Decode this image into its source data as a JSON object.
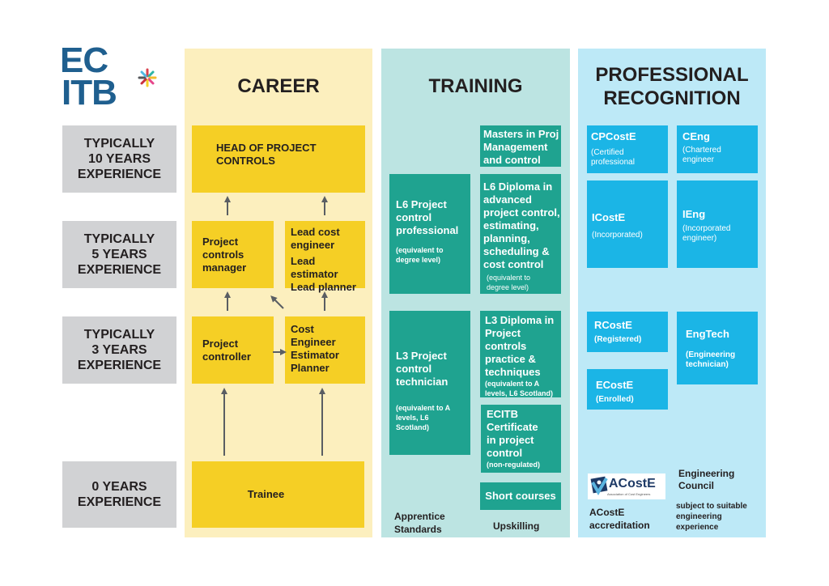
{
  "logo": {
    "line1": "EC",
    "line2": "ITB",
    "color": "#1f5f8f"
  },
  "experience_levels": [
    {
      "lines": [
        "TYPICALLY",
        "10 YEARS",
        "EXPERIENCE"
      ]
    },
    {
      "lines": [
        "TYPICALLY",
        "5 YEARS",
        "EXPERIENCE"
      ]
    },
    {
      "lines": [
        "TYPICALLY",
        "3 YEARS",
        "EXPERIENCE"
      ]
    },
    {
      "lines": [
        "0 YEARS",
        "EXPERIENCE"
      ]
    }
  ],
  "career": {
    "title": "CAREER",
    "head": {
      "lines": [
        "HEAD OF PROJECT",
        "CONTROLS"
      ]
    },
    "manager": {
      "lines": [
        "Project",
        "controls",
        "manager"
      ]
    },
    "lead": {
      "lines": [
        "Lead cost",
        "engineer",
        "Lead estimator",
        "Lead planner"
      ]
    },
    "controller": {
      "lines": [
        "Project",
        "controller"
      ]
    },
    "cost_engineer": {
      "lines": [
        "Cost",
        "Engineer",
        "Estimator",
        "Planner"
      ]
    },
    "trainee": {
      "label": "Trainee"
    }
  },
  "training": {
    "title": "TRAINING",
    "masters": {
      "lines": [
        "Masters in Proj",
        "Management",
        "and control"
      ]
    },
    "l6_professional": {
      "lines": [
        "L6 Project",
        "control",
        "professional"
      ],
      "sub": [
        "(equivalent to",
        "degree level)"
      ]
    },
    "l6_diploma": {
      "lines": [
        "L6 Diploma in",
        "advanced",
        "project control,",
        "estimating,",
        "planning,",
        "scheduling &",
        "cost control"
      ],
      "sub": [
        "(equivalent to",
        "degree level)"
      ]
    },
    "l3_technician": {
      "lines": [
        "L3 Project",
        "control",
        "technician"
      ],
      "sub": [
        "(equivalent to A",
        "levels, L6",
        "Scotland)"
      ]
    },
    "l3_diploma": {
      "lines": [
        "L3 Diploma in",
        "Project",
        "controls",
        "practice &",
        "techniques"
      ],
      "sub": [
        "(equivalent to A",
        "levels, L6 Scotland)"
      ]
    },
    "certificate": {
      "lines": [
        "ECITB",
        "Certificate",
        "in project",
        "control"
      ],
      "sub": [
        "(non-regulated)"
      ]
    },
    "short_courses": {
      "label": "Short courses"
    },
    "footer_left": [
      "Apprentice",
      "Standards"
    ],
    "footer_right": "Upskilling"
  },
  "recognition": {
    "title_lines": [
      "PROFESSIONAL",
      "RECOGNITION"
    ],
    "cpcoste": {
      "title": "CPCostE",
      "sub": [
        "(Certified",
        "professional"
      ]
    },
    "ceng": {
      "title": "CEng",
      "sub": [
        "(Chartered",
        "engineer"
      ]
    },
    "icoste": {
      "title": "ICostE",
      "sub": [
        "(Incorporated)"
      ]
    },
    "ieng": {
      "title": "IEng",
      "sub": [
        "(Incorporated",
        "engineer)"
      ]
    },
    "rcoste": {
      "title": "RCostE",
      "sub": [
        "(Registered)"
      ]
    },
    "engtech": {
      "title": "EngTech",
      "sub": [
        "(Engineering",
        "technician)"
      ]
    },
    "ecoste": {
      "title": "ECostE",
      "sub": [
        "(Enrolled)"
      ]
    },
    "acoste_logo": {
      "name": "ACostE",
      "tagline": "Association of Cost Engineers"
    },
    "acoste_label": [
      "ACostE",
      "accreditation"
    ],
    "ec_title": [
      "Engineering",
      "Council"
    ],
    "ec_sub": [
      "subject to suitable",
      "engineering",
      "experience"
    ]
  },
  "colors": {
    "career_panel": "#fcefbe",
    "career_box": "#f5cf25",
    "training_panel": "#bce4e2",
    "training_box": "#1fa390",
    "recognition_panel": "#bde9f7",
    "recognition_box": "#1bb5e6",
    "experience_box": "#d1d2d4",
    "arrow": "#5a5e63"
  }
}
